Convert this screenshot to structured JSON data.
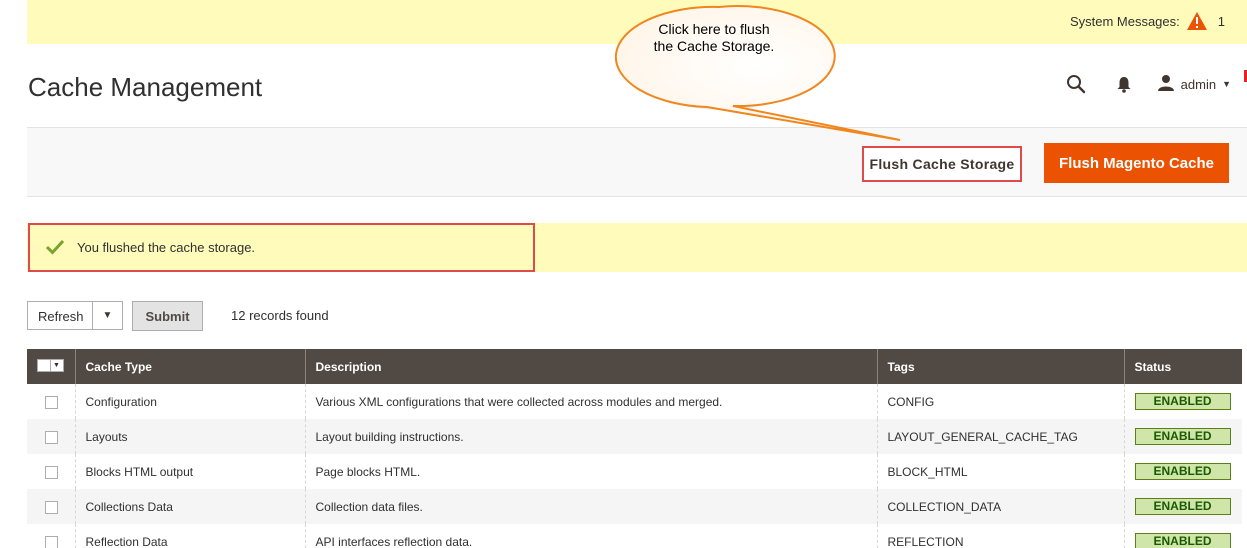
{
  "system_messages": {
    "label": "System Messages:",
    "count": "1",
    "icon": "warning-triangle-icon",
    "color": "#eb5202"
  },
  "page": {
    "title": "Cache Management"
  },
  "header": {
    "search_icon": "search-icon",
    "bell_icon": "bell-icon",
    "user_icon": "user-icon",
    "user_name": "admin"
  },
  "callout": {
    "text": "Click here to flush the Cache Storage."
  },
  "actions": {
    "flush_storage": "Flush Cache Storage",
    "flush_magento": "Flush Magento Cache",
    "accent": "#eb5202"
  },
  "message": {
    "text": "You flushed the cache storage.",
    "icon": "checkmark-icon"
  },
  "mass_action": {
    "selected": "Refresh",
    "submit": "Submit",
    "records": "12 records found"
  },
  "table": {
    "headers": [
      "Cache Type",
      "Description",
      "Tags",
      "Status"
    ],
    "rows": [
      {
        "type": "Configuration",
        "description": "Various XML configurations that were collected across modules and merged.",
        "tags": "CONFIG",
        "status": "ENABLED"
      },
      {
        "type": "Layouts",
        "description": "Layout building instructions.",
        "tags": "LAYOUT_GENERAL_CACHE_TAG",
        "status": "ENABLED"
      },
      {
        "type": "Blocks HTML output",
        "description": "Page blocks HTML.",
        "tags": "BLOCK_HTML",
        "status": "ENABLED"
      },
      {
        "type": "Collections Data",
        "description": "Collection data files.",
        "tags": "COLLECTION_DATA",
        "status": "ENABLED"
      },
      {
        "type": "Reflection Data",
        "description": "API interfaces reflection data.",
        "tags": "REFLECTION",
        "status": "ENABLED"
      }
    ]
  }
}
